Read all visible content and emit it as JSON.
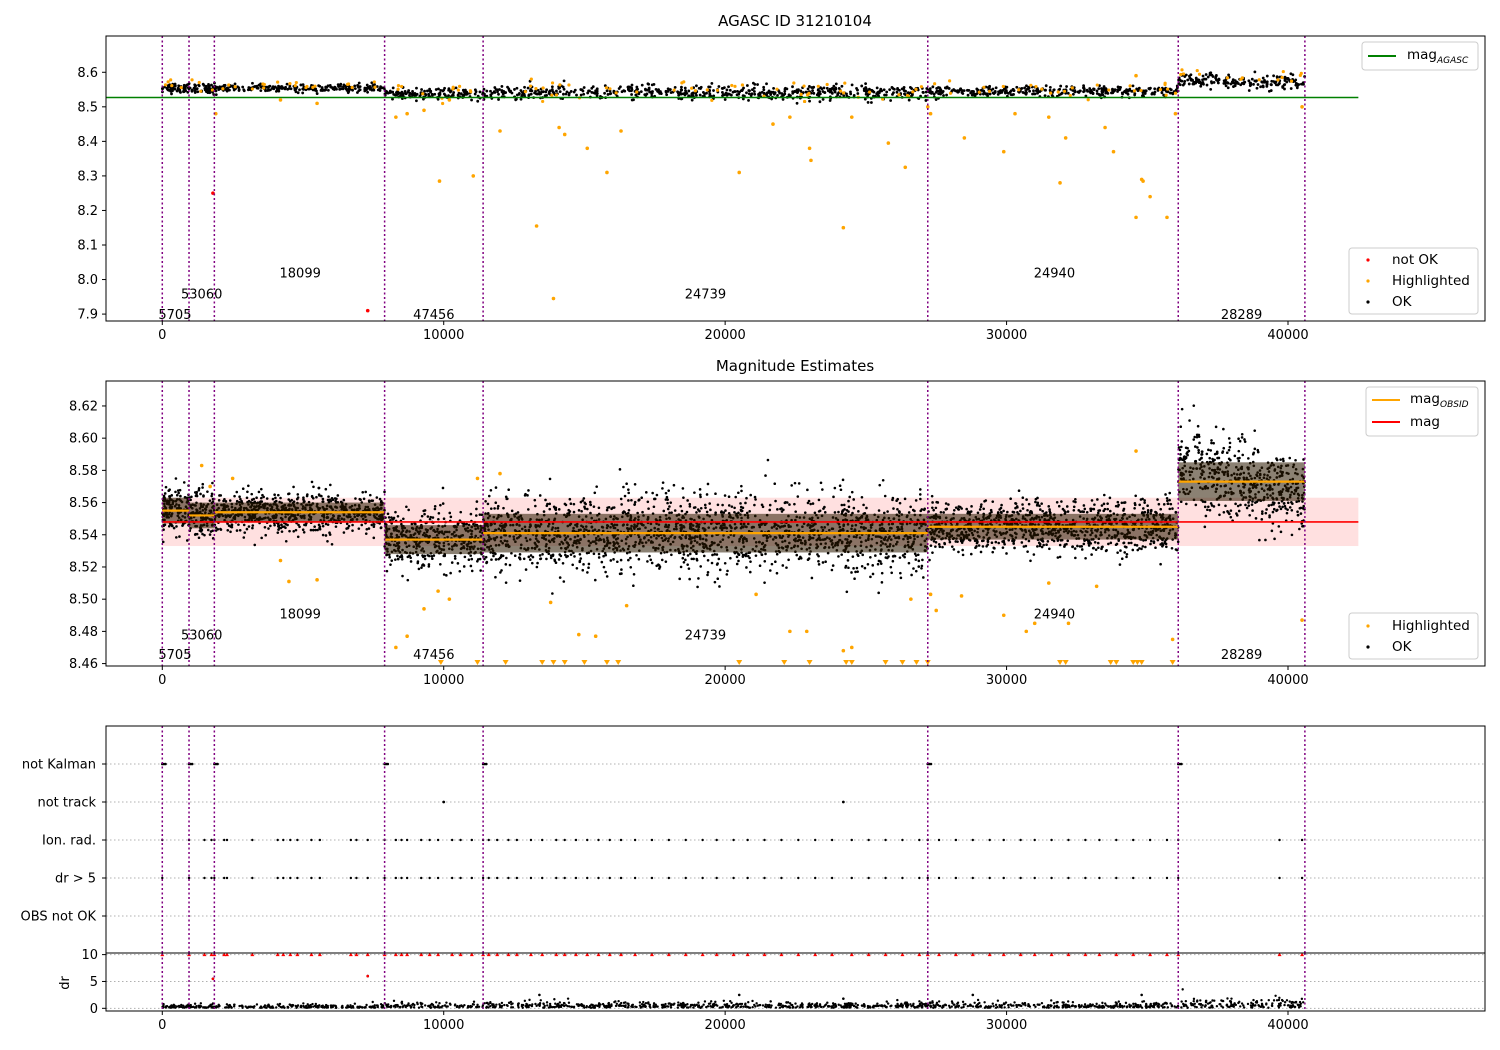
{
  "chart_data": [
    {
      "type": "scatter",
      "title": "AGASC ID 31210104",
      "xlabel": "",
      "ylabel": "",
      "xlim": [
        -2000,
        47000
      ],
      "ylim": [
        7.88,
        8.705
      ],
      "xticks": [
        0,
        10000,
        20000,
        30000,
        40000
      ],
      "yticks": [
        7.9,
        8.0,
        8.1,
        8.2,
        8.3,
        8.4,
        8.5,
        8.6
      ],
      "boundaries": [
        0,
        950,
        1850,
        7900,
        11400,
        27200,
        36100,
        40600
      ],
      "obsid_labels": [
        {
          "text": "5705",
          "x": 450,
          "y": 7.9
        },
        {
          "text": "53060",
          "x": 1400,
          "y": 7.96
        },
        {
          "text": "18099",
          "x": 4900,
          "y": 8.02
        },
        {
          "text": "47456",
          "x": 9650,
          "y": 7.9
        },
        {
          "text": "24739",
          "x": 19300,
          "y": 7.96
        },
        {
          "text": "24940",
          "x": 31700,
          "y": 8.02
        },
        {
          "text": "28289",
          "x": 38350,
          "y": 7.9
        }
      ],
      "mag_agasc": 8.527,
      "mag_agasc_xrange": [
        0,
        42500
      ],
      "segments": [
        {
          "x0": 0,
          "x1": 950,
          "mean": 8.555,
          "spread": 0.008
        },
        {
          "x0": 950,
          "x1": 1850,
          "mean": 8.552,
          "spread": 0.008
        },
        {
          "x0": 1850,
          "x1": 7900,
          "mean": 8.554,
          "spread": 0.006
        },
        {
          "x0": 7900,
          "x1": 11400,
          "mean": 8.537,
          "spread": 0.009
        },
        {
          "x0": 11400,
          "x1": 27200,
          "mean": 8.541,
          "spread": 0.012
        },
        {
          "x0": 27200,
          "x1": 36100,
          "mean": 8.545,
          "spread": 0.008
        },
        {
          "x0": 36100,
          "x1": 40600,
          "mean": 8.573,
          "spread": 0.012
        }
      ],
      "outliers_highlighted": [
        [
          1900,
          8.48
        ],
        [
          4200,
          8.52
        ],
        [
          5500,
          8.51
        ],
        [
          8300,
          8.47
        ],
        [
          8700,
          8.48
        ],
        [
          9300,
          8.49
        ],
        [
          9850,
          8.285
        ],
        [
          10200,
          8.52
        ],
        [
          11050,
          8.3
        ],
        [
          12000,
          8.43
        ],
        [
          13300,
          8.155
        ],
        [
          13900,
          7.945
        ],
        [
          14100,
          8.44
        ],
        [
          14300,
          8.42
        ],
        [
          15100,
          8.38
        ],
        [
          15800,
          8.31
        ],
        [
          16300,
          8.43
        ],
        [
          20500,
          8.31
        ],
        [
          21700,
          8.45
        ],
        [
          22300,
          8.47
        ],
        [
          23000,
          8.38
        ],
        [
          23050,
          8.345
        ],
        [
          24200,
          8.15
        ],
        [
          24500,
          8.47
        ],
        [
          25800,
          8.395
        ],
        [
          26400,
          8.325
        ],
        [
          27200,
          8.5
        ],
        [
          27300,
          8.48
        ],
        [
          28500,
          8.41
        ],
        [
          29900,
          8.37
        ],
        [
          30300,
          8.48
        ],
        [
          31500,
          8.47
        ],
        [
          31900,
          8.28
        ],
        [
          32100,
          8.41
        ],
        [
          33500,
          8.44
        ],
        [
          33800,
          8.37
        ],
        [
          34600,
          8.18
        ],
        [
          34800,
          8.29
        ],
        [
          34850,
          8.285
        ],
        [
          35100,
          8.24
        ],
        [
          35700,
          8.18
        ],
        [
          36000,
          8.48
        ],
        [
          34600,
          8.59
        ],
        [
          40500,
          8.5
        ]
      ],
      "outliers_not_ok": [
        [
          1800,
          8.25
        ],
        [
          7300,
          7.91
        ]
      ],
      "legends": {
        "upper": [
          "mag$_{AGASC}$"
        ],
        "lower": [
          "not OK",
          "Highlighted",
          "OK"
        ]
      }
    },
    {
      "type": "scatter",
      "title": "Magnitude Estimates",
      "xlabel": "",
      "ylabel": "",
      "xlim": [
        -2000,
        47000
      ],
      "ylim": [
        8.4585,
        8.6355
      ],
      "xticks": [
        0,
        10000,
        20000,
        30000,
        40000
      ],
      "yticks": [
        8.46,
        8.48,
        8.5,
        8.52,
        8.54,
        8.56,
        8.58,
        8.6,
        8.62
      ],
      "mag": 8.548,
      "mag_band": [
        8.533,
        8.563
      ],
      "mag_xrange": [
        -2000,
        42500
      ],
      "obsid_labels": [
        {
          "text": "5705",
          "x": 450,
          "y": 8.466
        },
        {
          "text": "53060",
          "x": 1400,
          "y": 8.478
        },
        {
          "text": "18099",
          "x": 4900,
          "y": 8.491
        },
        {
          "text": "47456",
          "x": 9650,
          "y": 8.466
        },
        {
          "text": "24739",
          "x": 19300,
          "y": 8.478
        },
        {
          "text": "24940",
          "x": 31700,
          "y": 8.491
        },
        {
          "text": "28289",
          "x": 38350,
          "y": 8.466
        }
      ],
      "highlighted_extra": [
        [
          1400,
          8.583
        ],
        [
          1700,
          8.57
        ],
        [
          2500,
          8.575
        ],
        [
          4200,
          8.524
        ],
        [
          4500,
          8.511
        ],
        [
          5500,
          8.512
        ],
        [
          8300,
          8.47
        ],
        [
          8700,
          8.477
        ],
        [
          9300,
          8.494
        ],
        [
          9800,
          8.505
        ],
        [
          10200,
          8.5
        ],
        [
          11200,
          8.575
        ],
        [
          12000,
          8.578
        ],
        [
          13800,
          8.498
        ],
        [
          14800,
          8.478
        ],
        [
          15400,
          8.477
        ],
        [
          16500,
          8.496
        ],
        [
          21100,
          8.503
        ],
        [
          22300,
          8.48
        ],
        [
          22900,
          8.48
        ],
        [
          24200,
          8.468
        ],
        [
          24500,
          8.47
        ],
        [
          26600,
          8.5
        ],
        [
          27300,
          8.503
        ],
        [
          27500,
          8.493
        ],
        [
          28400,
          8.502
        ],
        [
          29900,
          8.49
        ],
        [
          30700,
          8.48
        ],
        [
          31000,
          8.485
        ],
        [
          32200,
          8.485
        ],
        [
          31500,
          8.51
        ],
        [
          33200,
          8.508
        ],
        [
          34600,
          8.592
        ],
        [
          35900,
          8.475
        ],
        [
          40500,
          8.487
        ]
      ],
      "clipped_below_x": [
        9900,
        11200,
        12200,
        13500,
        13900,
        14300,
        15000,
        15800,
        16200,
        20500,
        22100,
        23000,
        24300,
        24500,
        25700,
        26300,
        26800,
        27200,
        31900,
        32100,
        33700,
        33900,
        34500,
        34650,
        34800,
        35900
      ],
      "legends": {
        "upper": [
          "mag$_{OBSID}$",
          "mag"
        ],
        "lower": [
          "Highlighted",
          "OK"
        ]
      }
    },
    {
      "type": "scatter",
      "title": "",
      "xlabel": "",
      "ylabel": "",
      "xlim": [
        -2000,
        47000
      ],
      "categories": [
        "not Kalman",
        "not track",
        "Ion. rad.",
        "dr > 5",
        "OBS not OK"
      ],
      "flag_x": [
        0,
        950,
        1850,
        7900,
        11400,
        27200,
        36100,
        1500,
        1750,
        2200,
        2300,
        3200,
        4100,
        4300,
        4550,
        4800,
        5300,
        5600,
        6700,
        6900,
        7300,
        8300,
        8500,
        8700,
        9200,
        9500,
        9800,
        10300,
        10600,
        11000,
        11600,
        11900,
        12300,
        12600,
        13100,
        13500,
        14000,
        14300,
        14700,
        15100,
        15500,
        15900,
        16300,
        16800,
        17400,
        18000,
        18600,
        19200,
        19700,
        20300,
        20800,
        21400,
        22000,
        22600,
        23200,
        23800,
        24500,
        25100,
        25700,
        26300,
        26900,
        27600,
        28200,
        28800,
        29400,
        29900,
        30500,
        31000,
        31600,
        32200,
        32800,
        33300,
        33900,
        34500,
        35100,
        35700,
        39700,
        40500
      ],
      "not_track_x": [
        10000,
        24200
      ]
    },
    {
      "type": "scatter",
      "title": "",
      "xlabel": "",
      "ylabel": "dr",
      "xlim": [
        -2000,
        47000
      ],
      "ylim": [
        -0.5,
        10.3
      ],
      "yticks": [
        0,
        5,
        10
      ],
      "dr_clipped_value": 10,
      "dr_outliers": [
        [
          1800,
          5.5
        ],
        [
          7300,
          6
        ],
        [
          13400,
          2.5
        ],
        [
          20500,
          2.5
        ],
        [
          24200,
          1.8
        ],
        [
          28800,
          2.5
        ],
        [
          34800,
          2.5
        ]
      ]
    }
  ],
  "colors": {
    "ok": "#000000",
    "highlighted": "#ffa500",
    "not_ok": "#ff0000",
    "agasc_line": "#008000",
    "mag_line": "#ff0000",
    "mag_band": "#ffcccc",
    "boundary": "#800080",
    "obsid_line": "#ffa500",
    "grid": "#b0b0b0"
  }
}
